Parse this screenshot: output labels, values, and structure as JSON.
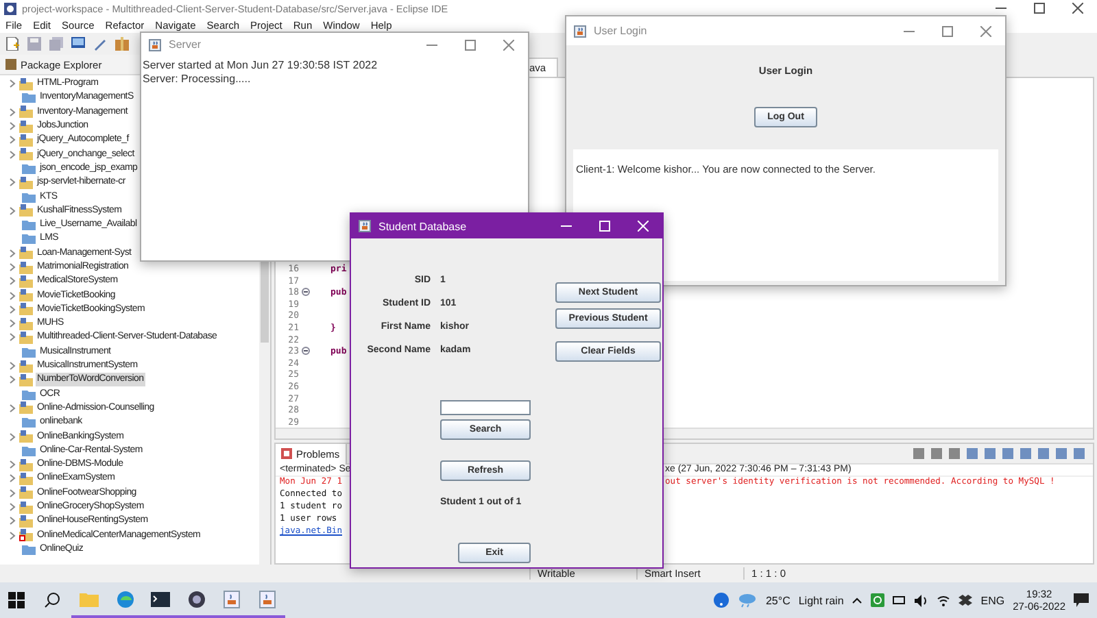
{
  "eclipse": {
    "title": "project-workspace - Multithreaded-Client-Server-Student-Database/src/Server.java - Eclipse IDE",
    "menu": [
      "File",
      "Edit",
      "Source",
      "Refactor",
      "Navigate",
      "Search",
      "Project",
      "Run",
      "Window",
      "Help"
    ],
    "package_explorer": {
      "tab": "Package Explorer",
      "items": [
        {
          "label": "HTML-Program",
          "kind": "project",
          "selected": false
        },
        {
          "label": "InventoryManagementS",
          "kind": "folder",
          "selected": false
        },
        {
          "label": "Inventory-Management",
          "kind": "project",
          "selected": false
        },
        {
          "label": "JobsJunction",
          "kind": "project",
          "selected": false
        },
        {
          "label": "jQuery_Autocomplete_f",
          "kind": "project",
          "selected": false
        },
        {
          "label": "jQuery_onchange_select",
          "kind": "project",
          "selected": false
        },
        {
          "label": "json_encode_jsp_examp",
          "kind": "folder",
          "selected": false
        },
        {
          "label": "jsp-servlet-hibernate-cr",
          "kind": "project",
          "selected": false
        },
        {
          "label": "KTS",
          "kind": "folder",
          "selected": false
        },
        {
          "label": "KushalFitnessSystem",
          "kind": "project",
          "selected": false
        },
        {
          "label": "Live_Username_Availabl",
          "kind": "folder",
          "selected": false
        },
        {
          "label": "LMS",
          "kind": "folder",
          "selected": false
        },
        {
          "label": "Loan-Management-Syst",
          "kind": "project",
          "selected": false
        },
        {
          "label": "MatrimonialRegistration",
          "kind": "project",
          "selected": false
        },
        {
          "label": "MedicalStoreSystem",
          "kind": "project",
          "selected": false
        },
        {
          "label": "MovieTicketBooking",
          "kind": "project",
          "selected": false
        },
        {
          "label": "MovieTicketBookingSystem",
          "kind": "project",
          "selected": false
        },
        {
          "label": "MUHS",
          "kind": "project",
          "selected": false
        },
        {
          "label": "Multithreaded-Client-Server-Student-Database",
          "kind": "project",
          "selected": false
        },
        {
          "label": "MusicalInstrument",
          "kind": "folder",
          "selected": false
        },
        {
          "label": "MusicalInstrumentSystem",
          "kind": "project",
          "selected": false
        },
        {
          "label": "NumberToWordConversion",
          "kind": "project",
          "selected": true
        },
        {
          "label": "OCR",
          "kind": "folder",
          "selected": false
        },
        {
          "label": "Online-Admission-Counselling",
          "kind": "project",
          "selected": false
        },
        {
          "label": "onlinebank",
          "kind": "folder",
          "selected": false
        },
        {
          "label": "OnlineBankingSystem",
          "kind": "project",
          "selected": false
        },
        {
          "label": "Online-Car-Rental-System",
          "kind": "folder",
          "selected": false
        },
        {
          "label": "Online-DBMS-Module",
          "kind": "project",
          "selected": false
        },
        {
          "label": "OnlineExamSystem",
          "kind": "project",
          "selected": false
        },
        {
          "label": "OnlineFootwearShopping",
          "kind": "project",
          "selected": false
        },
        {
          "label": "OnlineGroceryShopSystem",
          "kind": "project",
          "selected": false
        },
        {
          "label": "OnlineHouseRentingSystem",
          "kind": "project",
          "selected": false
        },
        {
          "label": "OnlineMedicalCenterManagementSystem",
          "kind": "project_error",
          "selected": false
        },
        {
          "label": "OnlineQuiz",
          "kind": "folder",
          "selected": false
        }
      ]
    },
    "editor": {
      "tab": "ava",
      "lines": [
        {
          "number": "16",
          "code": "pri",
          "fold": false
        },
        {
          "number": "17",
          "fold": false
        },
        {
          "number": "18",
          "code": "pub",
          "fold": true
        },
        {
          "number": "19",
          "fold": false
        },
        {
          "number": "20",
          "fold": false
        },
        {
          "number": "21",
          "code": "}",
          "fold": false
        },
        {
          "number": "22",
          "fold": false
        },
        {
          "number": "23",
          "code": "pub",
          "fold": true
        },
        {
          "number": "24",
          "fold": false
        },
        {
          "number": "25",
          "fold": false
        },
        {
          "number": "26",
          "fold": false
        },
        {
          "number": "27",
          "fold": false
        },
        {
          "number": "28",
          "fold": false
        },
        {
          "number": "29",
          "fold": false
        }
      ]
    },
    "console": {
      "tab": "Problems",
      "header_left": "<terminated> Se",
      "header_right": "xe (27 Jun, 2022 7:30:46 PM – 7:31:43 PM)",
      "lines": [
        {
          "kind": "error",
          "left": "Mon Jun 27 1",
          "right": "out server's identity verification is not recommended. According to MySQL !"
        },
        {
          "kind": "plain",
          "left": "Connected to"
        },
        {
          "kind": "plain",
          "left": "1 student ro"
        },
        {
          "kind": "plain",
          "left": "1 user rows"
        },
        {
          "kind": "link",
          "left": "java.net.Bin"
        }
      ]
    },
    "status_bar": [
      "Writable",
      "Smart Insert",
      "1 : 1 : 0"
    ]
  },
  "server_window": {
    "title": "Server",
    "lines": [
      "Server started at Mon Jun 27 19:30:58 IST 2022",
      "Server: Processing....."
    ]
  },
  "login_window": {
    "title": "User Login",
    "heading": "User Login",
    "button": "Log Out",
    "message": "Client-1: Welcome kishor... You are now connected to the Server."
  },
  "student_window": {
    "title": "Student Database",
    "fields": [
      {
        "label": "SID",
        "value": "1"
      },
      {
        "label": "Student ID",
        "value": "101"
      },
      {
        "label": "First Name",
        "value": "kishor"
      },
      {
        "label": "Second Name",
        "value": "kadam"
      }
    ],
    "nav_buttons": [
      "Next Student",
      "Previous Student",
      "Clear Fields"
    ],
    "search_button": "Search",
    "refresh_button": "Refresh",
    "counter": "Student 1 out of 1",
    "exit_button": "Exit"
  },
  "taskbar": {
    "apps": [
      {
        "kind": "explorer",
        "running": true
      },
      {
        "kind": "browser",
        "running": true
      },
      {
        "kind": "terminal",
        "running": true
      },
      {
        "kind": "recorder",
        "running": true
      },
      {
        "kind": "java",
        "running": true
      },
      {
        "kind": "java",
        "running": true
      }
    ],
    "temperature": "25°C",
    "weather": "Light rain",
    "language": "ENG",
    "time": "19:32",
    "date": "27-06-2022"
  }
}
